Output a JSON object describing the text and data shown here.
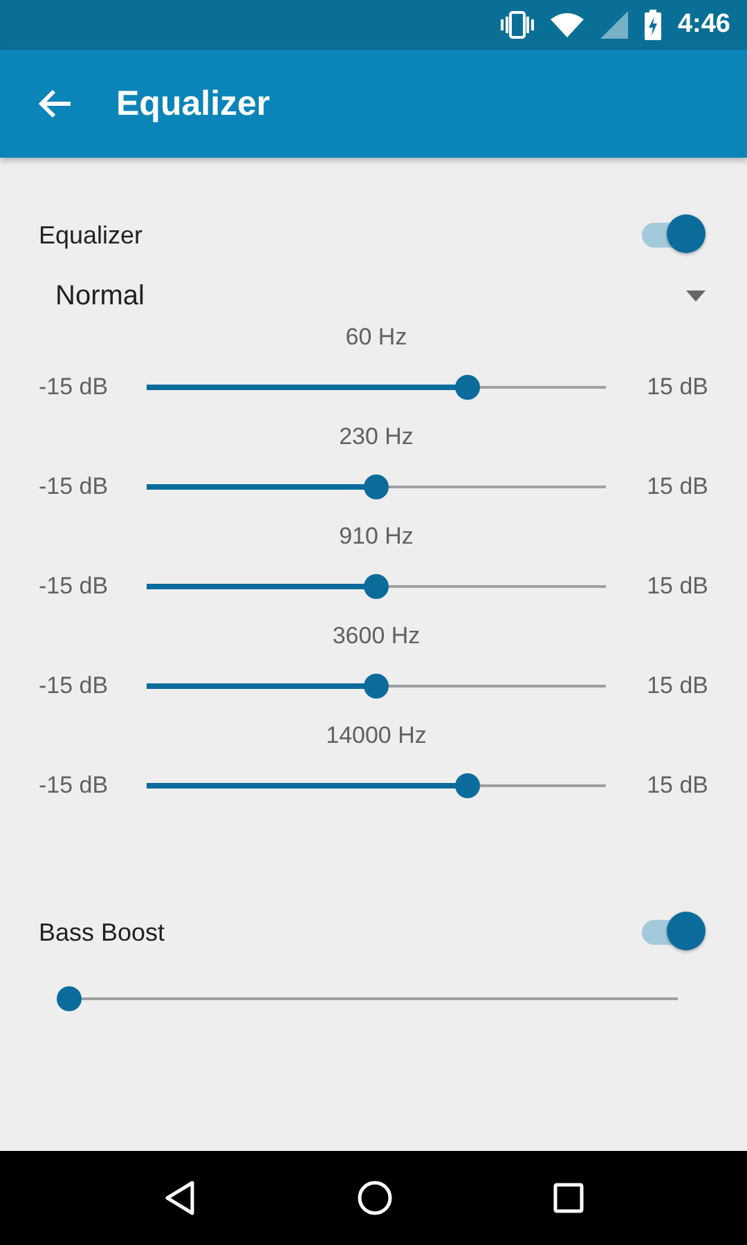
{
  "status_bar": {
    "time": "4:46"
  },
  "app_bar": {
    "title": "Equalizer"
  },
  "equalizer": {
    "label": "Equalizer",
    "on": true,
    "preset": {
      "value": "Normal"
    },
    "bands": [
      {
        "frequency": "60 Hz",
        "min": "-15 dB",
        "max": "15 dB",
        "level": 0.7
      },
      {
        "frequency": "230 Hz",
        "min": "-15 dB",
        "max": "15 dB",
        "level": 0.5
      },
      {
        "frequency": "910 Hz",
        "min": "-15 dB",
        "max": "15 dB",
        "level": 0.5
      },
      {
        "frequency": "3600 Hz",
        "min": "-15 dB",
        "max": "15 dB",
        "level": 0.5
      },
      {
        "frequency": "14000 Hz",
        "min": "-15 dB",
        "max": "15 dB",
        "level": 0.7
      }
    ]
  },
  "bass_boost": {
    "label": "Bass Boost",
    "on": true,
    "level": 0
  }
}
